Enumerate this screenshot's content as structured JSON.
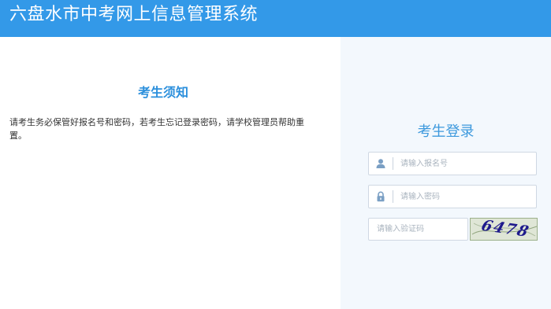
{
  "header": {
    "title": "六盘水市中考网上信息管理系统"
  },
  "notice": {
    "title": "考生须知",
    "text": "请考生务必保管好报名号和密码，若考生忘记登录密码，请学校管理员帮助重置。"
  },
  "login": {
    "title": "考生登录",
    "username_placeholder": "请输入报名号",
    "username_icon": "user-icon",
    "password_placeholder": "请输入密码",
    "password_icon": "lock-icon",
    "captcha_placeholder": "请输入验证码",
    "captcha_code": "6478"
  },
  "colors": {
    "header_bg": "#3399e8",
    "accent": "#2b8fdc",
    "panel_bg": "#f3f8fd"
  }
}
